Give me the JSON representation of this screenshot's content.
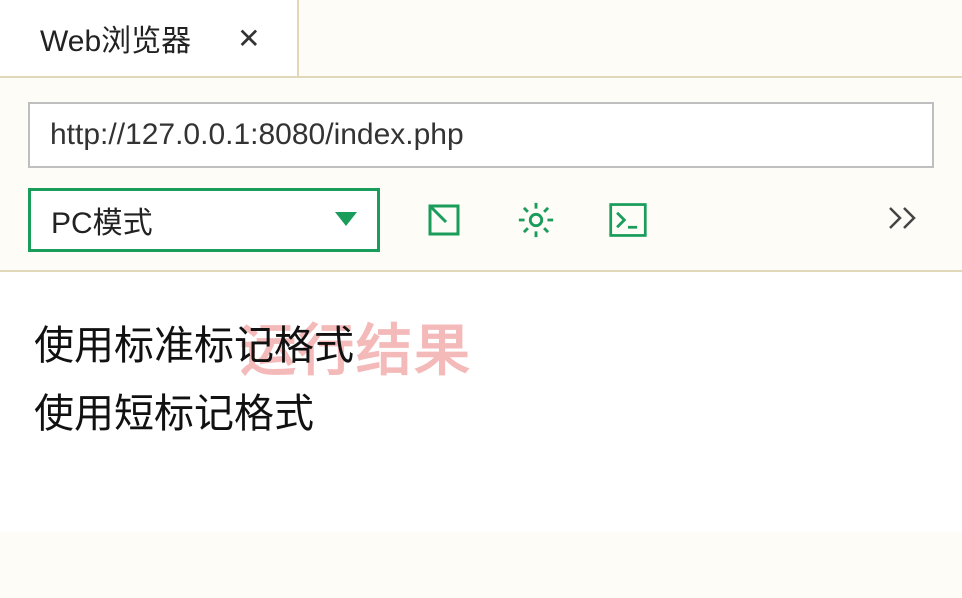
{
  "tab": {
    "title": "Web浏览器"
  },
  "address": {
    "url": "http://127.0.0.1:8080/index.php"
  },
  "toolbar": {
    "mode_label": "PC模式"
  },
  "content": {
    "line1": "使用标准标记格式",
    "line2": "使用短标记格式",
    "watermark": "运行结果"
  },
  "colors": {
    "accent": "#1a9c5a"
  }
}
